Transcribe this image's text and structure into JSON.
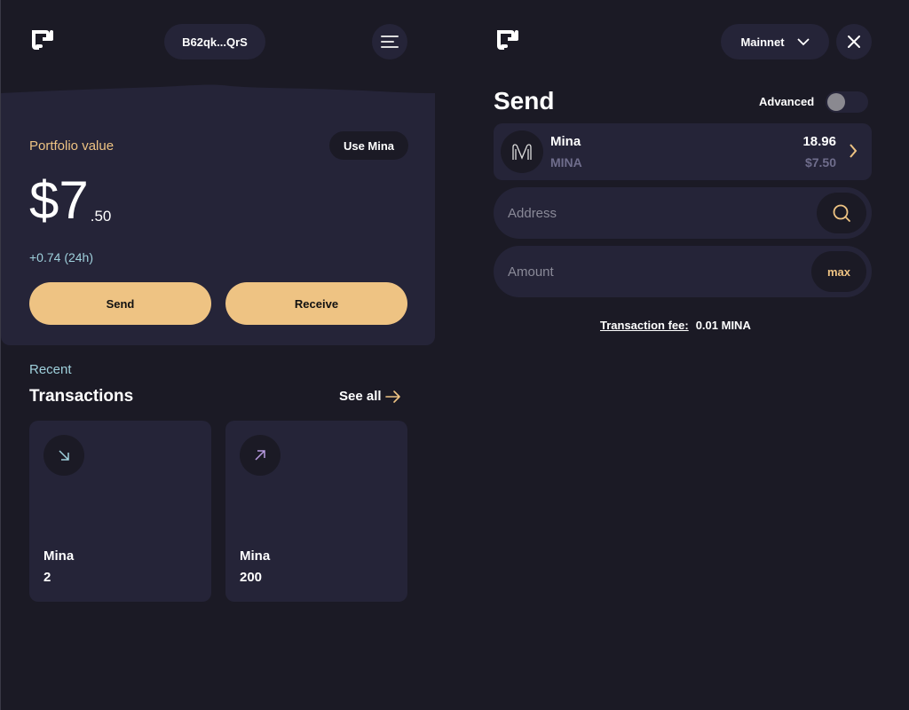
{
  "wallet": {
    "address_short": "B62qk...QrS",
    "portfolio_label": "Portfolio value",
    "use_token_label": "Use Mina",
    "balance_main": "$7",
    "balance_cents": ".50",
    "change_24h": "+0.74 (24h)",
    "send_label": "Send",
    "receive_label": "Receive",
    "recent_label": "Recent",
    "transactions_title": "Transactions",
    "see_all_label": "See all",
    "transactions": [
      {
        "direction": "incoming",
        "icon": "arrow-down-right-icon",
        "token": "Mina",
        "amount": "2"
      },
      {
        "direction": "outgoing",
        "icon": "arrow-up-right-icon",
        "token": "Mina",
        "amount": "200"
      }
    ]
  },
  "send": {
    "network": "Mainnet",
    "title": "Send",
    "advanced_label": "Advanced",
    "advanced_enabled": false,
    "token": {
      "name": "Mina",
      "symbol": "MINA",
      "balance": "18.96",
      "value": "$7.50"
    },
    "address_placeholder": "Address",
    "amount_placeholder": "Amount",
    "max_label": "max",
    "fee_label": "Transaction fee:",
    "fee_value": "0.01 MINA"
  },
  "colors": {
    "background": "#1b1a25",
    "card": "#252438",
    "accent": "#eec383",
    "teal": "#9fd0dc",
    "purple": "#b89ae0"
  }
}
